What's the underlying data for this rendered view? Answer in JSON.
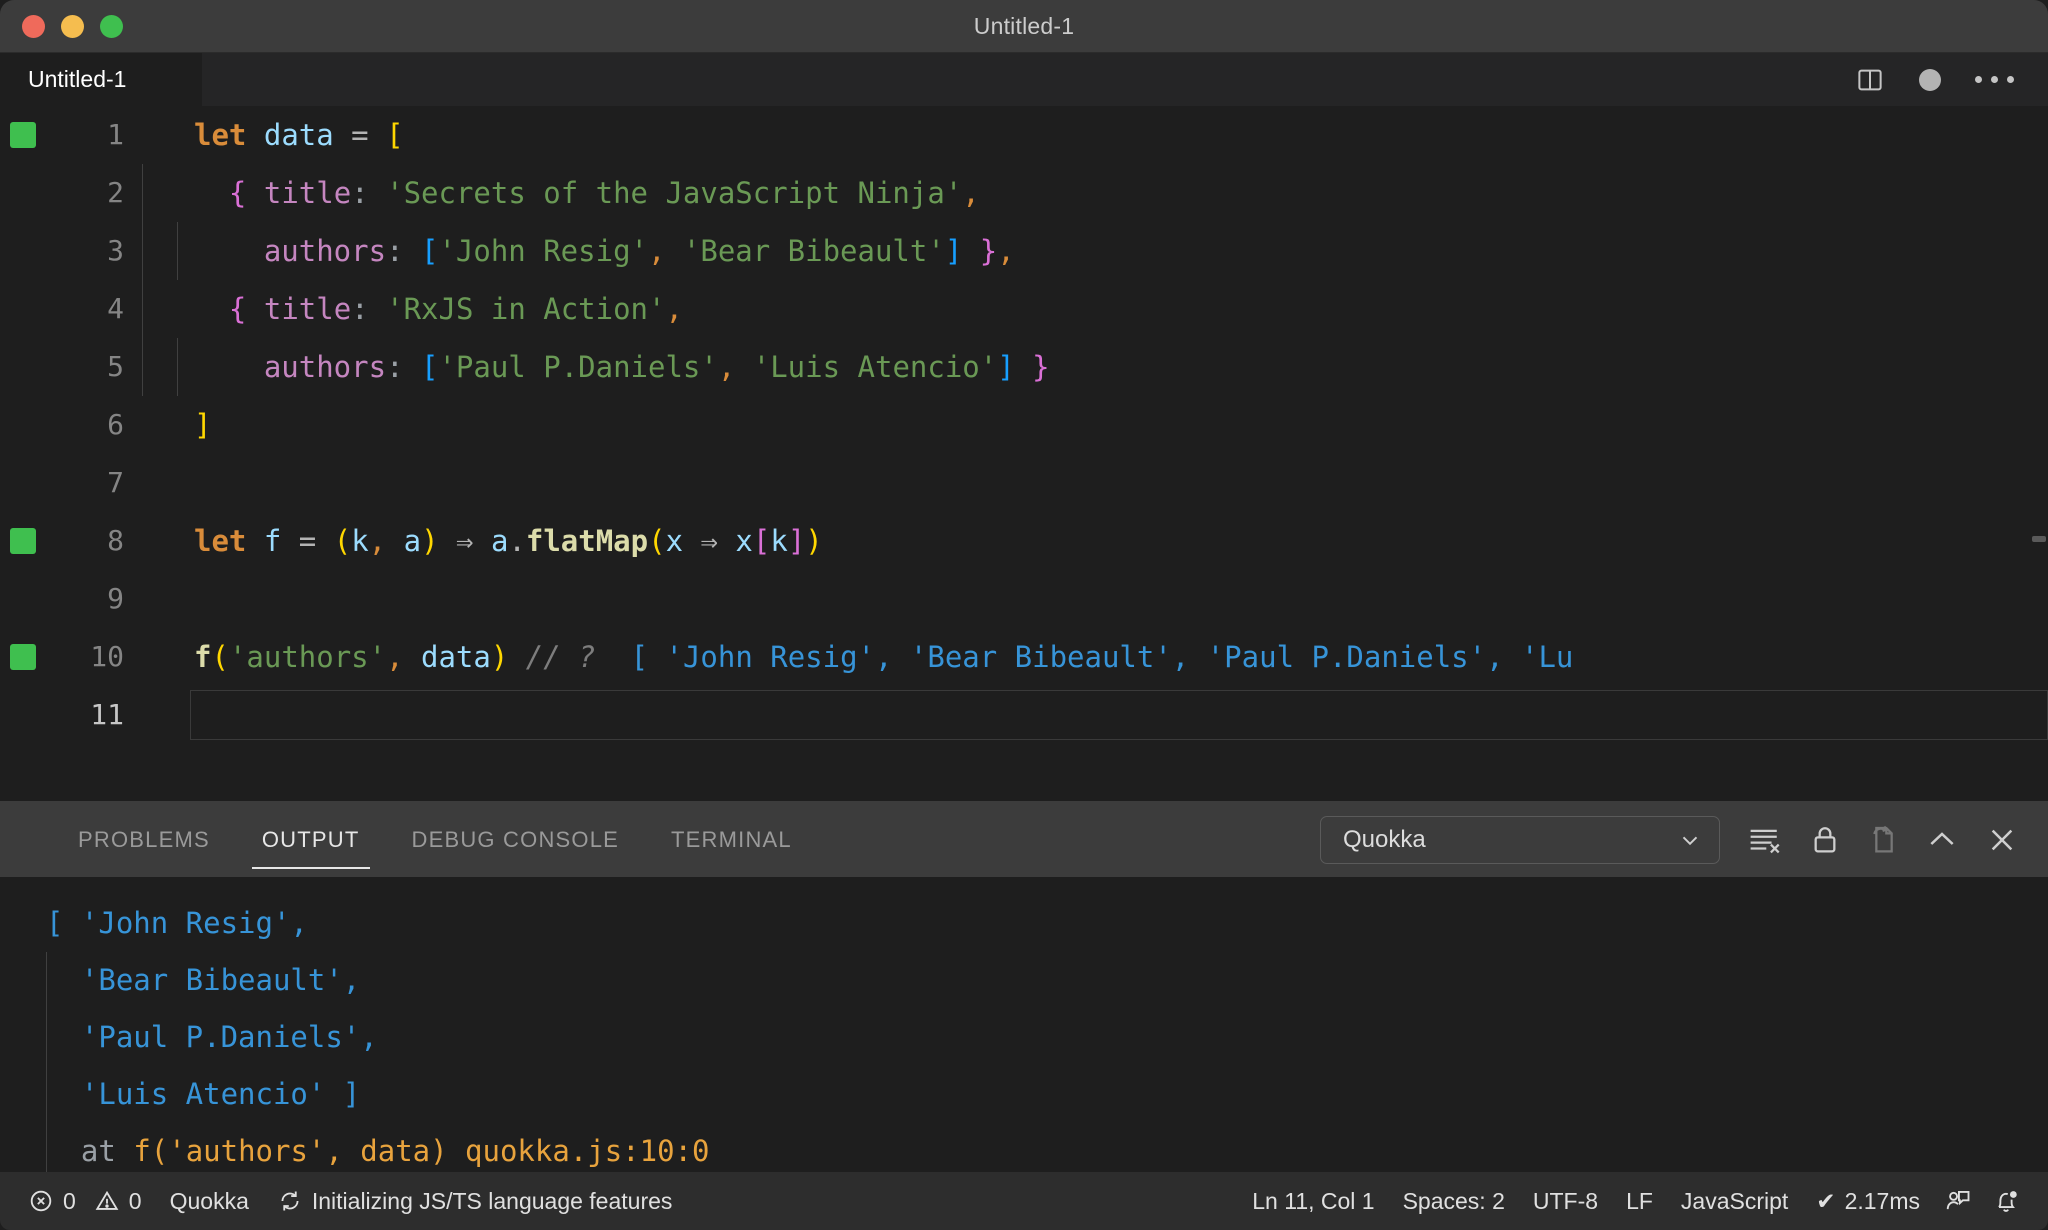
{
  "window": {
    "title": "Untitled-1",
    "traffic_lights": [
      "close-red",
      "minimize-yellow",
      "maximize-green"
    ]
  },
  "editor_tabbar": {
    "tab_label": "Untitled-1",
    "actions": [
      "split-editor-icon",
      "unsaved-dot-icon",
      "more-actions-icon"
    ]
  },
  "editor": {
    "language": "JavaScript",
    "lines": [
      {
        "num": "1",
        "quokka_marker": true,
        "tokens": [
          {
            "t": "let",
            "c": "t-key"
          },
          {
            "t": " ",
            "c": "t-plain"
          },
          {
            "t": "data",
            "c": "t-var"
          },
          {
            "t": " ",
            "c": "t-plain"
          },
          {
            "t": "=",
            "c": "t-op"
          },
          {
            "t": " ",
            "c": "t-plain"
          },
          {
            "t": "[",
            "c": "t-brkY"
          }
        ]
      },
      {
        "num": "2",
        "quokka_marker": false,
        "indent_guides": 1,
        "tokens": [
          {
            "t": "  ",
            "c": "t-plain"
          },
          {
            "t": "{",
            "c": "t-brkP"
          },
          {
            "t": " ",
            "c": "t-plain"
          },
          {
            "t": "title",
            "c": "t-prop"
          },
          {
            "t": ":",
            "c": "t-colon"
          },
          {
            "t": " ",
            "c": "t-plain"
          },
          {
            "t": "'Secrets of the JavaScript Ninja'",
            "c": "t-str"
          },
          {
            "t": ",",
            "c": "t-comma"
          }
        ]
      },
      {
        "num": "3",
        "quokka_marker": false,
        "indent_guides": 2,
        "tokens": [
          {
            "t": "    ",
            "c": "t-plain"
          },
          {
            "t": "authors",
            "c": "t-prop"
          },
          {
            "t": ":",
            "c": "t-colon"
          },
          {
            "t": " ",
            "c": "t-plain"
          },
          {
            "t": "[",
            "c": "t-brkB"
          },
          {
            "t": "'John Resig'",
            "c": "t-str"
          },
          {
            "t": ",",
            "c": "t-comma"
          },
          {
            "t": " ",
            "c": "t-plain"
          },
          {
            "t": "'Bear Bibeault'",
            "c": "t-str"
          },
          {
            "t": "]",
            "c": "t-brkB"
          },
          {
            "t": " ",
            "c": "t-plain"
          },
          {
            "t": "}",
            "c": "t-brkP"
          },
          {
            "t": ",",
            "c": "t-comma"
          }
        ]
      },
      {
        "num": "4",
        "quokka_marker": false,
        "indent_guides": 1,
        "tokens": [
          {
            "t": "  ",
            "c": "t-plain"
          },
          {
            "t": "{",
            "c": "t-brkP"
          },
          {
            "t": " ",
            "c": "t-plain"
          },
          {
            "t": "title",
            "c": "t-prop"
          },
          {
            "t": ":",
            "c": "t-colon"
          },
          {
            "t": " ",
            "c": "t-plain"
          },
          {
            "t": "'RxJS in Action'",
            "c": "t-str"
          },
          {
            "t": ",",
            "c": "t-comma"
          }
        ]
      },
      {
        "num": "5",
        "quokka_marker": false,
        "indent_guides": 2,
        "tokens": [
          {
            "t": "    ",
            "c": "t-plain"
          },
          {
            "t": "authors",
            "c": "t-prop"
          },
          {
            "t": ":",
            "c": "t-colon"
          },
          {
            "t": " ",
            "c": "t-plain"
          },
          {
            "t": "[",
            "c": "t-brkB"
          },
          {
            "t": "'Paul P.Daniels'",
            "c": "t-str"
          },
          {
            "t": ",",
            "c": "t-comma"
          },
          {
            "t": " ",
            "c": "t-plain"
          },
          {
            "t": "'Luis Atencio'",
            "c": "t-str"
          },
          {
            "t": "]",
            "c": "t-brkB"
          },
          {
            "t": " ",
            "c": "t-plain"
          },
          {
            "t": "}",
            "c": "t-brkP"
          }
        ]
      },
      {
        "num": "6",
        "quokka_marker": false,
        "tokens": [
          {
            "t": "]",
            "c": "t-brkY"
          }
        ]
      },
      {
        "num": "7",
        "quokka_marker": false,
        "tokens": []
      },
      {
        "num": "8",
        "quokka_marker": true,
        "tokens": [
          {
            "t": "let",
            "c": "t-key"
          },
          {
            "t": " ",
            "c": "t-plain"
          },
          {
            "t": "f",
            "c": "t-var"
          },
          {
            "t": " ",
            "c": "t-plain"
          },
          {
            "t": "=",
            "c": "t-op"
          },
          {
            "t": " ",
            "c": "t-plain"
          },
          {
            "t": "(",
            "c": "t-brkY"
          },
          {
            "t": "k",
            "c": "t-var"
          },
          {
            "t": ",",
            "c": "t-comma"
          },
          {
            "t": " ",
            "c": "t-plain"
          },
          {
            "t": "a",
            "c": "t-var"
          },
          {
            "t": ")",
            "c": "t-brkY"
          },
          {
            "t": " ⇒ ",
            "c": "t-op"
          },
          {
            "t": "a",
            "c": "t-var"
          },
          {
            "t": ".",
            "c": "t-plain"
          },
          {
            "t": "flatMap",
            "c": "t-fn"
          },
          {
            "t": "(",
            "c": "t-brkY"
          },
          {
            "t": "x",
            "c": "t-var"
          },
          {
            "t": " ⇒ ",
            "c": "t-op"
          },
          {
            "t": "x",
            "c": "t-var"
          },
          {
            "t": "[",
            "c": "t-brkP"
          },
          {
            "t": "k",
            "c": "t-var"
          },
          {
            "t": "]",
            "c": "t-brkP"
          },
          {
            "t": ")",
            "c": "t-brkY"
          }
        ]
      },
      {
        "num": "9",
        "quokka_marker": false,
        "tokens": []
      },
      {
        "num": "10",
        "quokka_marker": true,
        "tokens": [
          {
            "t": "f",
            "c": "t-fn"
          },
          {
            "t": "(",
            "c": "t-brkY"
          },
          {
            "t": "'authors'",
            "c": "t-str"
          },
          {
            "t": ",",
            "c": "t-comma"
          },
          {
            "t": " ",
            "c": "t-plain"
          },
          {
            "t": "data",
            "c": "t-var"
          },
          {
            "t": ")",
            "c": "t-brkY"
          },
          {
            "t": " ",
            "c": "t-plain"
          },
          {
            "t": "// ?",
            "c": "t-comment"
          },
          {
            "t": "  ",
            "c": "t-plain"
          },
          {
            "t": "[ 'John Resig', 'Bear Bibeault', 'Paul P.Daniels', 'Lu",
            "c": "t-result"
          }
        ]
      },
      {
        "num": "11",
        "quokka_marker": false,
        "current": true,
        "tokens": []
      }
    ]
  },
  "panel": {
    "tabs": [
      {
        "label": "PROBLEMS",
        "active": false
      },
      {
        "label": "OUTPUT",
        "active": true
      },
      {
        "label": "DEBUG CONSOLE",
        "active": false
      },
      {
        "label": "TERMINAL",
        "active": false
      }
    ],
    "channel_selected": "Quokka",
    "actions": [
      "clear-output-icon",
      "lock-scroll-icon",
      "open-in-editor-icon",
      "collapse-panel-icon",
      "close-panel-icon"
    ],
    "output_lines": [
      {
        "indent_guide": false,
        "segments": [
          {
            "t": "[ 'John Resig',",
            "c": "t-result"
          }
        ]
      },
      {
        "indent_guide": true,
        "segments": [
          {
            "t": "  'Bear Bibeault',",
            "c": "t-result"
          }
        ]
      },
      {
        "indent_guide": true,
        "segments": [
          {
            "t": "  'Paul P.Daniels',",
            "c": "t-result"
          }
        ]
      },
      {
        "indent_guide": true,
        "segments": [
          {
            "t": "  'Luis Atencio' ]",
            "c": "t-result"
          }
        ]
      },
      {
        "indent_guide": true,
        "segments": [
          {
            "t": "  at ",
            "c": "t-tracedim"
          },
          {
            "t": "f('authors', data) quokka.js:10:0",
            "c": "t-trace"
          }
        ]
      }
    ]
  },
  "statusbar": {
    "errors_count": "0",
    "warnings_count": "0",
    "quokka_label": "Quokka",
    "task_status": "Initializing JS/TS language features",
    "cursor_position": "Ln 11, Col 1",
    "indentation": "Spaces: 2",
    "encoding": "UTF-8",
    "eol": "LF",
    "language_mode": "JavaScript",
    "run_time": "2.17ms",
    "run_time_prefix": "✔",
    "right_icons": [
      "feedback-icon",
      "notifications-bell-icon"
    ]
  },
  "colors": {
    "titlebar_bg": "#3c3c3c",
    "editor_bg": "#1e1e1e",
    "panel_header_bg": "#3c3c3c",
    "statusbar_bg": "#2d2d2d",
    "quokka_marker": "#3fbf4f",
    "result_blue": "#3794d8",
    "string_green": "#6a9955",
    "keyword_orange": "#d98c3a",
    "property_purple": "#c586c0",
    "function_yellow": "#dcdcaa",
    "bracket_yellow": "#ffd700",
    "bracket_purple": "#da70d6",
    "bracket_blue": "#179fff",
    "trace_orange": "#e8a33d"
  }
}
